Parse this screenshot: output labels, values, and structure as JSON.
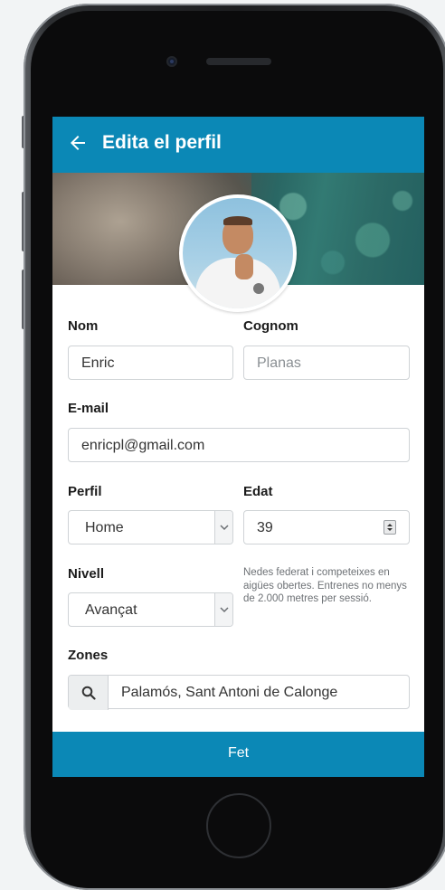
{
  "header": {
    "title": "Edita el perfil",
    "back_icon": "arrow-left-icon",
    "color": "#0b88b6"
  },
  "form": {
    "nom": {
      "label": "Nom",
      "value": "Enric"
    },
    "cognom": {
      "label": "Cognom",
      "placeholder": "Planas"
    },
    "email": {
      "label": "E-mail",
      "value": "enricpl@gmail.com"
    },
    "perfil": {
      "label": "Perfil",
      "value": "Home"
    },
    "edat": {
      "label": "Edat",
      "value": "39"
    },
    "nivell": {
      "label": "Nivell",
      "value": "Avançat",
      "hint": "Nedes federat i competeixes en aigües obertes. Entrenes no menys de 2.000 metres per sessió."
    },
    "zones": {
      "label": "Zones",
      "value": "Palamós, Sant Antoni de Calonge",
      "icon": "search-icon"
    }
  },
  "footer": {
    "done_label": "Fet"
  }
}
